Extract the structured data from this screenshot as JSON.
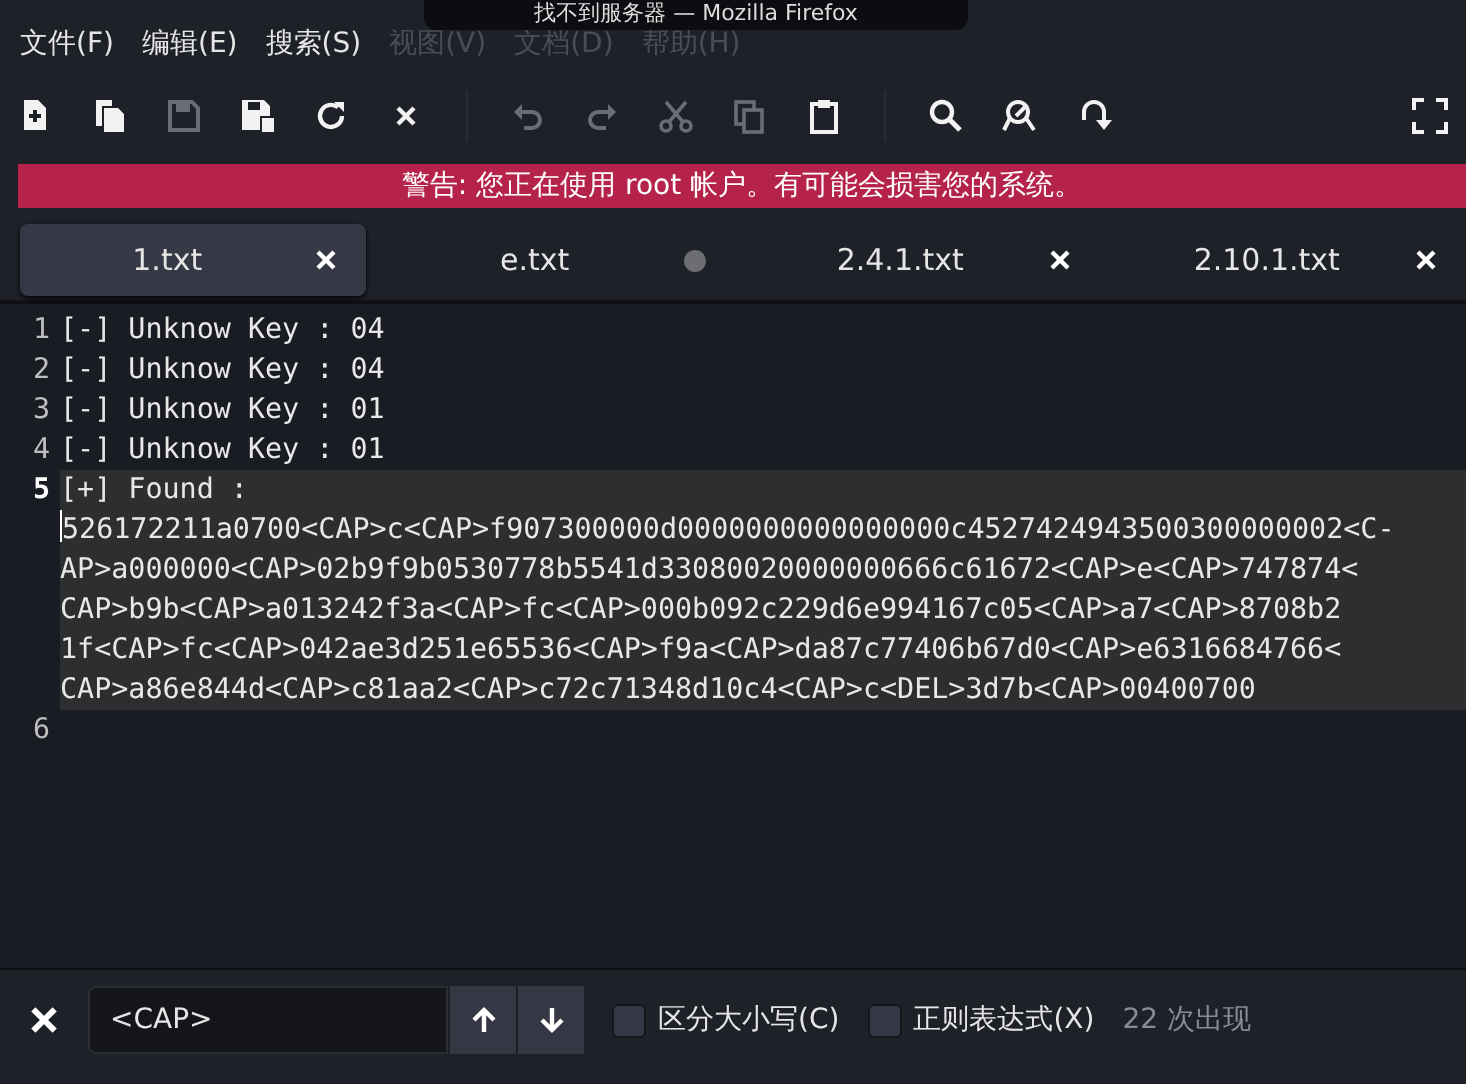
{
  "tooltip": {
    "text": "找不到服务器 — Mozilla Firefox"
  },
  "menu": [
    {
      "label": "文件(F)",
      "dimmed": false
    },
    {
      "label": "编辑(E)",
      "dimmed": false
    },
    {
      "label": "搜索(S)",
      "dimmed": false
    },
    {
      "label": "视图(V)",
      "dimmed": true
    },
    {
      "label": "文档(D)",
      "dimmed": true
    },
    {
      "label": "帮助(H)",
      "dimmed": true
    }
  ],
  "toolbar": [
    {
      "kind": "new",
      "disabled": false
    },
    {
      "kind": "new-window",
      "disabled": false
    },
    {
      "kind": "save",
      "disabled": true
    },
    {
      "kind": "save-as",
      "disabled": false
    },
    {
      "kind": "reload",
      "disabled": false
    },
    {
      "kind": "close",
      "disabled": false
    },
    {
      "kind": "sep"
    },
    {
      "kind": "undo",
      "disabled": true
    },
    {
      "kind": "redo",
      "disabled": true
    },
    {
      "kind": "cut",
      "disabled": true
    },
    {
      "kind": "copy",
      "disabled": true
    },
    {
      "kind": "paste",
      "disabled": false
    },
    {
      "kind": "sep"
    },
    {
      "kind": "search",
      "disabled": false
    },
    {
      "kind": "replace",
      "disabled": false
    },
    {
      "kind": "goto",
      "disabled": false
    },
    {
      "kind": "spacer"
    },
    {
      "kind": "fullscreen",
      "disabled": false
    }
  ],
  "warning": "警告: 您正在使用 root 帐户。有可能会损害您的系统。",
  "tabs": [
    {
      "label": "1.txt",
      "selected": true,
      "modified": false
    },
    {
      "label": "e.txt",
      "selected": false,
      "modified": true
    },
    {
      "label": "2.4.1.txt",
      "selected": false,
      "modified": false
    },
    {
      "label": "2.10.1.txt",
      "selected": false,
      "modified": false
    }
  ],
  "lines": [
    {
      "number": "1",
      "text": "[-] Unknow Key : 04",
      "current": false
    },
    {
      "number": "2",
      "text": "[-] Unknow Key : 04",
      "current": false
    },
    {
      "number": "3",
      "text": "[-] Unknow Key : 01",
      "current": false
    },
    {
      "number": "4",
      "text": "[-] Unknow Key : 01",
      "current": false
    },
    {
      "number": "5",
      "text": "[+] Found :",
      "current": true,
      "wrapped": [
        "526172211a0700<CAP>c<CAP>f907300000d0000000000000000c4527424943500300000002<C-",
        "AP>a000000<CAP>02b9f9b0530778b5541d33080020000000666c61672<CAP>e<CAP>747874<",
        "CAP>b9b<CAP>a013242f3a<CAP>fc<CAP>000b092c229d6e994167c05<CAP>a7<CAP>8708b2",
        "1f<CAP>fc<CAP>042ae3d251e65536<CAP>f9a<CAP>da87c77406b67d0<CAP>e6316684766<",
        "CAP>a86e844d<CAP>c81aa2<CAP>c72c71348d10c4<CAP>c<DEL>3d7b<CAP>00400700"
      ]
    },
    {
      "number": "6",
      "current": false
    }
  ],
  "find": {
    "value": "<CAP>",
    "options": [
      {
        "label": "区分大小写(C)",
        "checked": false
      },
      {
        "label": "正则表达式(X)",
        "checked": false
      }
    ],
    "count": "22 次出现"
  }
}
